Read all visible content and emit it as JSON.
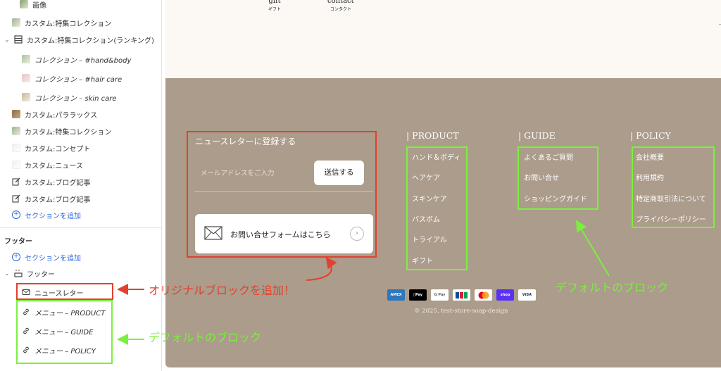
{
  "sidebar": {
    "items": [
      {
        "label": "画像"
      },
      {
        "label": "カスタム:特集コレクション"
      },
      {
        "label": "カスタム:特集コレクション(ランキング)"
      },
      {
        "label": "コレクション – #hand&body"
      },
      {
        "label": "コレクション – #hair care"
      },
      {
        "label": "コレクション – skin care"
      },
      {
        "label": "カスタム:パララックス"
      },
      {
        "label": "カスタム:特集コレクション"
      },
      {
        "label": "カスタム:コンセプト"
      },
      {
        "label": "カスタム:ニュース"
      },
      {
        "label": "カスタム:ブログ記事"
      },
      {
        "label": "カスタム:ブログ記事"
      }
    ],
    "add_section_label": "セクションを追加",
    "footer_heading": "フッター",
    "footer_add_section_label": "セクションを追加",
    "footer_group_label": "フッター",
    "footer_blocks": [
      {
        "label": "ニュースレター"
      },
      {
        "label": "メニュー – PRODUCT"
      },
      {
        "label": "メニュー – GUIDE"
      },
      {
        "label": "メニュー – POLICY"
      }
    ]
  },
  "preview": {
    "nav": [
      {
        "en": "gift",
        "jp": "ギフト"
      },
      {
        "en": "contact",
        "jp": "コンタクト"
      }
    ],
    "corner_mark": "-",
    "newsletter": {
      "title": "ニュースレターに登録する",
      "placeholder": "メールアドレスをご入力",
      "submit": "送信する",
      "contact_label": "お問い合せフォームはこちら",
      "contact_arrow": "›"
    },
    "columns": [
      {
        "title": "| PRODUCT",
        "items": [
          "ハンド＆ボディ",
          "ヘアケア",
          "スキンケア",
          "バスボム",
          "トライアル",
          "ギフト"
        ]
      },
      {
        "title": "| GUIDE",
        "items": [
          "よくあるご質問",
          "お問い合せ",
          "ショッピングガイド"
        ]
      },
      {
        "title": "| POLICY",
        "items": [
          "会社概要",
          "利用規約",
          "特定商取引法について",
          "プライバシーポリシー"
        ]
      }
    ],
    "payments": [
      {
        "label": "AMEX",
        "color": "#2e77bc"
      },
      {
        "label": "Pay",
        "color": "#000000"
      },
      {
        "label": "G Pay",
        "color": "#ffffff"
      },
      {
        "label": "JCB",
        "color": "#ffffff"
      },
      {
        "label": "MC",
        "color": "#ffffff"
      },
      {
        "label": "shop",
        "color": "#5a31f4"
      },
      {
        "label": "VISA",
        "color": "#ffffff"
      }
    ],
    "copyright": "© 2025, test-store-soap-design"
  },
  "annotations": {
    "original_block": "オリジナルブロックを追加！",
    "default_block_right": "デフォルトのブロック",
    "default_block_left": "デフォルトのブロック",
    "red_color": "#e4402e",
    "green_color": "#7cf03c"
  }
}
